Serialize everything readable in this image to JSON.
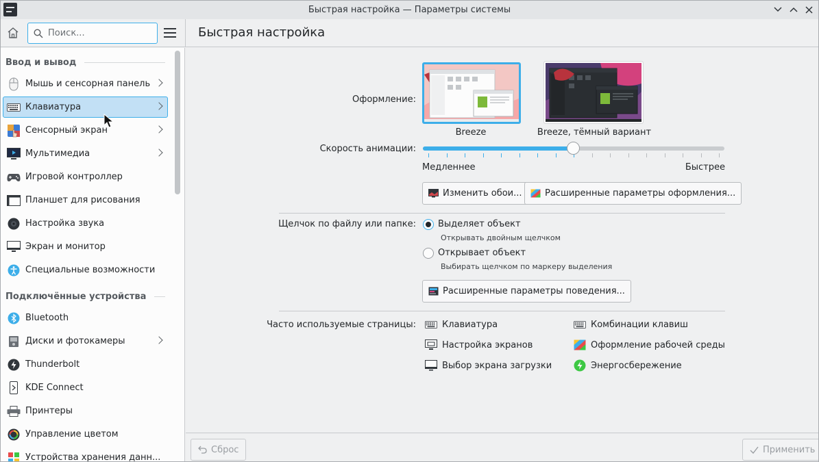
{
  "window": {
    "title": "Быстрая настройка — Параметры системы"
  },
  "header": {
    "search_placeholder": "Поиск...",
    "page_title": "Быстрая настройка"
  },
  "sidebar": {
    "sections": [
      {
        "title": "Ввод и вывод",
        "items": [
          {
            "label": "Мышь и сенсорная панель",
            "icon": "mouse-icon",
            "has_children": true
          },
          {
            "label": "Клавиатура",
            "icon": "keyboard-icon",
            "has_children": true,
            "selected": true
          },
          {
            "label": "Сенсорный экран",
            "icon": "touchscreen-icon",
            "has_children": true
          },
          {
            "label": "Мультимедиа",
            "icon": "multimedia-icon",
            "has_children": true
          },
          {
            "label": "Игровой контроллер",
            "icon": "gamepad-icon",
            "has_children": false
          },
          {
            "label": "Планшет для рисования",
            "icon": "tablet-icon",
            "has_children": false
          },
          {
            "label": "Настройка звука",
            "icon": "speaker-icon",
            "has_children": false
          },
          {
            "label": "Экран и монитор",
            "icon": "monitor-icon",
            "has_children": false
          },
          {
            "label": "Специальные возможности",
            "icon": "accessibility-icon",
            "has_children": false
          }
        ]
      },
      {
        "title": "Подключённые устройства",
        "items": [
          {
            "label": "Bluetooth",
            "icon": "bluetooth-icon",
            "has_children": false
          },
          {
            "label": "Диски и фотокамеры",
            "icon": "disk-icon",
            "has_children": true
          },
          {
            "label": "Thunderbolt",
            "icon": "thunderbolt-icon",
            "has_children": false
          },
          {
            "label": "KDE Connect",
            "icon": "kdeconnect-icon",
            "has_children": false
          },
          {
            "label": "Принтеры",
            "icon": "printer-icon",
            "has_children": false
          },
          {
            "label": "Управление цветом",
            "icon": "color-management-icon",
            "has_children": false
          },
          {
            "label": "Устройства хранения данн...",
            "icon": "storage-icon",
            "has_children": false
          }
        ]
      }
    ]
  },
  "main": {
    "appearance_label": "Оформление:",
    "themes": [
      {
        "name": "Breeze",
        "selected": true
      },
      {
        "name": "Breeze, тёмный вариант",
        "selected": false
      }
    ],
    "animation_label": "Скорость анимации:",
    "animation_slower": "Медленнее",
    "animation_faster": "Быстрее",
    "animation_level": 0.5,
    "change_wallpaper_button": "Изменить обои...",
    "advanced_appearance_button": "Расширенные параметры оформления...",
    "click_label": "Щелчок по файлу или папке:",
    "click_options": [
      {
        "label": "Выделяет объект",
        "hint": "Открывать двойным щелчком",
        "checked": true
      },
      {
        "label": "Открывает объект",
        "hint": "Выбирать щелчком по маркеру выделения",
        "checked": false
      }
    ],
    "advanced_behavior_button": "Расширенные параметры поведения...",
    "frequent_label": "Часто используемые страницы:",
    "frequent_pages": [
      {
        "label": "Клавиатура",
        "icon": "keyboard-icon"
      },
      {
        "label": "Комбинации клавиш",
        "icon": "shortcuts-icon"
      },
      {
        "label": "Настройка экранов",
        "icon": "display-config-icon"
      },
      {
        "label": "Оформление рабочей среды",
        "icon": "appearance-icon"
      },
      {
        "label": "Выбор экрана загрузки",
        "icon": "boot-splash-icon"
      },
      {
        "label": "Энергосбережение",
        "icon": "power-icon"
      }
    ]
  },
  "footer": {
    "reset_button": "Сброс",
    "apply_button": "Применить"
  },
  "colors": {
    "accent": "#3daee9",
    "selection_bg": "#c2e0f5",
    "window_bg": "#eff0f1",
    "view_bg": "#fcfcfc",
    "power_green": "#3dc844"
  }
}
